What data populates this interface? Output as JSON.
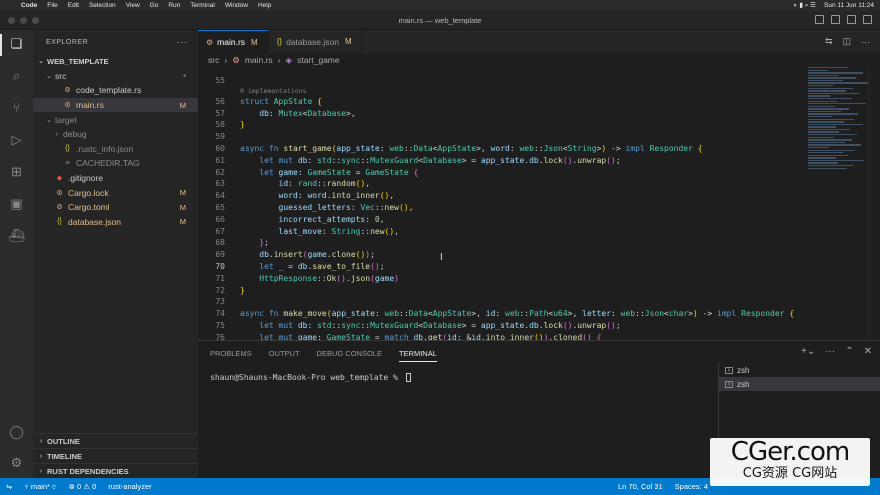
{
  "menubar": {
    "app": "Code",
    "items": [
      "File",
      "Edit",
      "Selection",
      "View",
      "Go",
      "Run",
      "Terminal",
      "Window",
      "Help"
    ],
    "clock": "Sun 11 Jun  11:24"
  },
  "window": {
    "title": "main.rs — web_template"
  },
  "activity": {
    "icons": [
      "files-icon",
      "search-icon",
      "source-control-icon",
      "run-debug-icon",
      "extensions-icon",
      "remote-explorer-icon",
      "docker-icon",
      "account-icon",
      "settings-gear-icon"
    ],
    "scm_badge": "1"
  },
  "sidebar": {
    "title": "EXPLORER",
    "project": "WEB_TEMPLATE",
    "tree": [
      {
        "label": "src",
        "type": "folder-open",
        "depth": 1,
        "dot": true
      },
      {
        "label": "code_template.rs",
        "type": "rs",
        "depth": 2
      },
      {
        "label": "main.rs",
        "type": "rs",
        "depth": 2,
        "badge": "M",
        "selected": true
      },
      {
        "label": "target",
        "type": "folder-open",
        "depth": 1,
        "dim": true
      },
      {
        "label": "debug",
        "type": "folder",
        "depth": 2,
        "dim": true
      },
      {
        "label": ".rustc_info.json",
        "type": "json",
        "depth": 2,
        "dim": true
      },
      {
        "label": "CACHEDIR.TAG",
        "type": "file",
        "depth": 2,
        "dim": true
      },
      {
        "label": ".gitignore",
        "type": "git",
        "depth": 1
      },
      {
        "label": "Cargo.lock",
        "type": "cargo",
        "depth": 1,
        "badge": "M"
      },
      {
        "label": "Cargo.toml",
        "type": "cargo",
        "depth": 1,
        "badge": "M"
      },
      {
        "label": "database.json",
        "type": "json",
        "depth": 1,
        "badge": "M"
      }
    ],
    "sections": [
      "OUTLINE",
      "TIMELINE",
      "RUST DEPENDENCIES"
    ]
  },
  "tabs": [
    {
      "icon": "⚙",
      "label": "main.rs",
      "badge": "M",
      "active": true
    },
    {
      "icon": "{}",
      "label": "database.json",
      "badge": "M",
      "active": false
    }
  ],
  "breadcrumb": [
    "src",
    "main.rs",
    "start_game"
  ],
  "code": {
    "inlay_hint": "0 implementations",
    "cursor_line": "70",
    "lines": [
      {
        "n": "55",
        "html": ""
      },
      {
        "n": "56",
        "html": "<span class='kw'>struct</span> <span class='ty'>AppState</span> <span class='pu'>{</span>"
      },
      {
        "n": "57",
        "html": "    <span class='va'>db</span>: <span class='ty'>Mutex</span><<span class='ty'>Database</span>>,"
      },
      {
        "n": "58",
        "html": "<span class='pu'>}</span>"
      },
      {
        "n": "59",
        "html": ""
      },
      {
        "n": "60",
        "html": "<span class='kw'>async</span> <span class='kw'>fn</span> <span class='fn'>start_game</span><span class='pu'>(</span><span class='va'>app_state</span>: <span class='ty'>web</span>::<span class='ty'>Data</span><<span class='ty'>AppState</span>>, <span class='va'>word</span>: <span class='ty'>web</span>::<span class='ty'>Json</span><<span class='ty'>String</span>><span class='pu'>)</span> -> <span class='kw'>impl</span> <span class='ty'>Responder</span> <span class='pu'>{</span>"
      },
      {
        "n": "61",
        "html": "    <span class='kw'>let</span> <span class='kw'>mut</span> <span class='va'>db</span>: <span class='ty'>std</span>::<span class='ty'>sync</span>::<span class='ty'>MutexGuard</span><<span class='ty'>Database</span>> = <span class='va'>app_state</span>.<span class='va'>db</span>.<span class='fn'>lock</span><span class='pp'>()</span>.<span class='fn'>unwrap</span><span class='pp'>()</span>;"
      },
      {
        "n": "62",
        "html": "    <span class='kw'>let</span> <span class='va'>game</span>: <span class='ty'>GameState</span> = <span class='ty'>GameState</span> <span class='pp'>{</span>"
      },
      {
        "n": "63",
        "html": "        <span class='va'>id</span>: <span class='ty'>rand</span>::<span class='fn'>random</span><span class='pu'>()</span>,"
      },
      {
        "n": "64",
        "html": "        <span class='va'>word</span>: <span class='va'>word</span>.<span class='fn'>into_inner</span><span class='pu'>()</span>,"
      },
      {
        "n": "65",
        "html": "        <span class='va'>guessed_letters</span>: <span class='ty'>Vec</span>::<span class='fn'>new</span><span class='pu'>()</span>,"
      },
      {
        "n": "66",
        "html": "        <span class='va'>incorrect_attempts</span>: <span class='nu'>0</span>,"
      },
      {
        "n": "67",
        "html": "        <span class='va'>last_move</span>: <span class='ty'>String</span>::<span class='fn'>new</span><span class='pu'>()</span>,"
      },
      {
        "n": "68",
        "html": "    <span class='pp'>}</span>;"
      },
      {
        "n": "69",
        "html": "    <span class='va'>db</span>.<span class='fn'>insert</span><span class='pp'>(</span><span class='va'>game</span>.<span class='fn'>clone</span><span class='pu'>()</span><span class='pp'>)</span>;"
      },
      {
        "n": "70",
        "html": "    <span class='kw'>let</span> _ = <span class='va'>db</span>.<span class='fn'>save_to_file</span><span class='pp'>()</span>;"
      },
      {
        "n": "71",
        "html": "    <span class='ty'>HttpResponse</span>::<span class='fn'>Ok</span><span class='pp'>()</span>.<span class='fn'>json</span><span class='pp'>(</span><span class='va'>game</span><span class='pp'>)</span>"
      },
      {
        "n": "72",
        "html": "<span class='pu'>}</span>"
      },
      {
        "n": "73",
        "html": ""
      },
      {
        "n": "74",
        "html": "<span class='kw'>async</span> <span class='kw'>fn</span> <span class='fn'>make_move</span><span class='pu'>(</span><span class='va'>app_state</span>: <span class='ty'>web</span>::<span class='ty'>Data</span><<span class='ty'>AppState</span>>, <span class='va'>id</span>: <span class='ty'>web</span>::<span class='ty'>Path</span><<span class='ty'>u64</span>>, <span class='va'>letter</span>: <span class='ty'>web</span>::<span class='ty'>Json</span><<span class='ty'>char</span>><span class='pu'>)</span> -> <span class='kw'>impl</span> <span class='ty'>Responder</span> <span class='pu'>{</span>"
      },
      {
        "n": "75",
        "html": "    <span class='kw'>let</span> <span class='kw'>mut</span> <span class='va'>db</span>: <span class='ty'>std</span>::<span class='ty'>sync</span>::<span class='ty'>MutexGuard</span><<span class='ty'>Database</span>> = <span class='va'>app_state</span>.<span class='va'>db</span>.<span class='fn'>lock</span><span class='pp'>()</span>.<span class='fn'>unwrap</span><span class='pp'>()</span>;"
      },
      {
        "n": "76",
        "html": "    <span class='kw'>let</span> <span class='kw'>mut</span> <span class='va'>game</span>: <span class='ty'>GameState</span> = <span class='kw'>match</span> <span class='va'>db</span>.<span class='fn'>get</span><span class='pp'>(</span><span class='va'>id</span>: &<span class='va'>id</span>.<span class='fn'>into_inner</span><span class='pu'>()</span><span class='pp'>)</span>.<span class='fn'>cloned</span><span class='pp'>()</span> <span class='pp'>{</span>"
      }
    ]
  },
  "panel": {
    "tabs": [
      "PROBLEMS",
      "OUTPUT",
      "DEBUG CONSOLE",
      "TERMINAL"
    ],
    "active": "TERMINAL",
    "prompt": "shaun@Shauns-MacBook-Pro web_template % ",
    "terminals": [
      "zsh",
      "zsh"
    ]
  },
  "statusbar": {
    "branch": "main*",
    "sync": "⟳",
    "errors": "⊗ 0 ⚠ 0",
    "analyzer": "rust-analyzer",
    "position": "Ln 70, Col 31",
    "spaces": "Spaces: 4"
  },
  "watermark": {
    "big": "CGer.com",
    "small": "CG资源 CG网站"
  }
}
